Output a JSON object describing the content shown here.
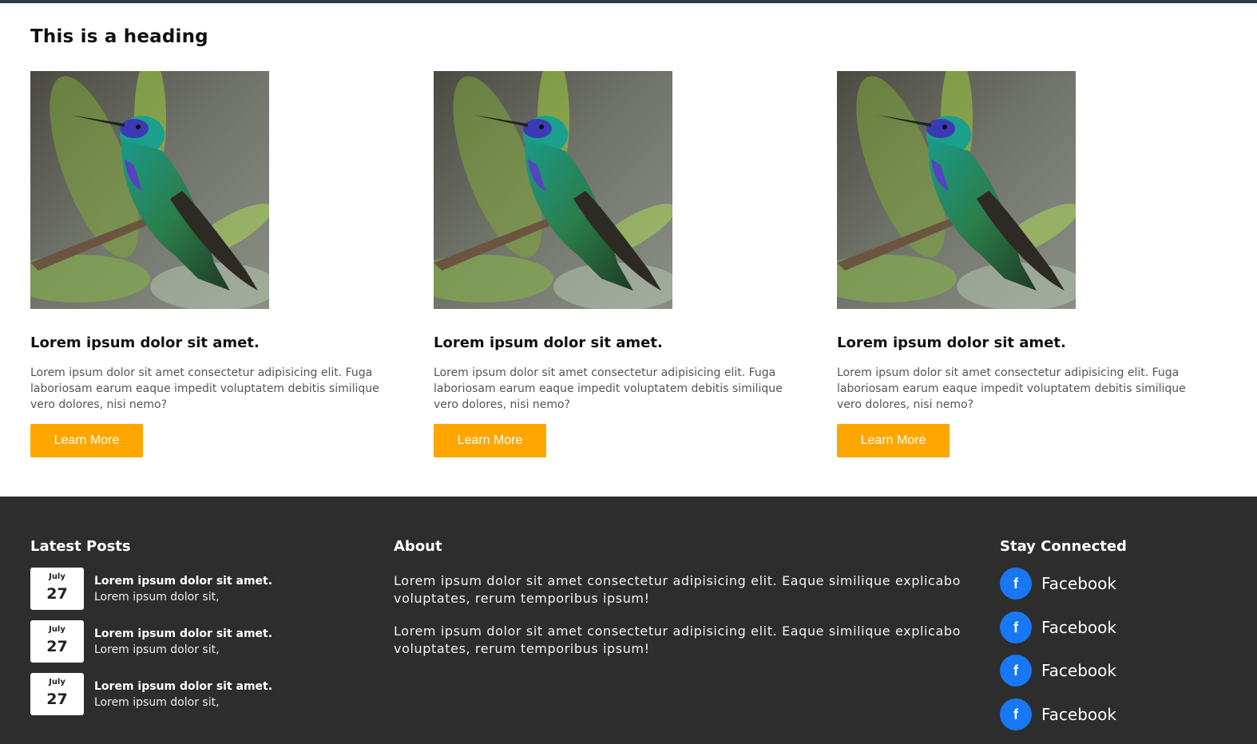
{
  "page": {
    "heading": "This is a heading"
  },
  "cards": [
    {
      "image_alt": "hummingbird-photo",
      "title": "Lorem ipsum dolor sit amet.",
      "text": "Lorem ipsum dolor sit amet consectetur adipisicing elit. Fuga laboriosam earum eaque impedit voluptatem debitis similique vero dolores, nisi nemo?",
      "button_label": "Learn More"
    },
    {
      "image_alt": "hummingbird-photo",
      "title": "Lorem ipsum dolor sit amet.",
      "text": "Lorem ipsum dolor sit amet consectetur adipisicing elit. Fuga laboriosam earum eaque impedit voluptatem debitis similique vero dolores, nisi nemo?",
      "button_label": "Learn More"
    },
    {
      "image_alt": "hummingbird-photo",
      "title": "Lorem ipsum dolor sit amet.",
      "text": "Lorem ipsum dolor sit amet consectetur adipisicing elit. Fuga laboriosam earum eaque impedit voluptatem debitis similique vero dolores, nisi nemo?",
      "button_label": "Learn More"
    }
  ],
  "footer": {
    "latest_posts": {
      "heading": "Latest Posts",
      "posts": [
        {
          "month": "July",
          "day": "27",
          "title": "Lorem ipsum dolor sit amet.",
          "excerpt": "Lorem ipsum dolor sit,"
        },
        {
          "month": "July",
          "day": "27",
          "title": "Lorem ipsum dolor sit amet.",
          "excerpt": "Lorem ipsum dolor sit,"
        },
        {
          "month": "July",
          "day": "27",
          "title": "Lorem ipsum dolor sit amet.",
          "excerpt": "Lorem ipsum dolor sit,"
        }
      ]
    },
    "about": {
      "heading": "About",
      "paragraphs": [
        "Lorem ipsum dolor sit amet consectetur adipisicing elit. Eaque similique explicabo voluptates, rerum temporibus ipsum!",
        "Lorem ipsum dolor sit amet consectetur adipisicing elit. Eaque similique explicabo voluptates, rerum temporibus ipsum!"
      ]
    },
    "stay_connected": {
      "heading": "Stay Connected",
      "links": [
        {
          "icon": "facebook-icon",
          "label": "Facebook"
        },
        {
          "icon": "facebook-icon",
          "label": "Facebook"
        },
        {
          "icon": "facebook-icon",
          "label": "Facebook"
        },
        {
          "icon": "facebook-icon",
          "label": "Facebook"
        }
      ]
    }
  },
  "colors": {
    "accent_button": "#ffa600",
    "footer_bg": "#2d2d2d",
    "facebook_blue": "#1877f2",
    "top_rule": "#2e3a44"
  }
}
